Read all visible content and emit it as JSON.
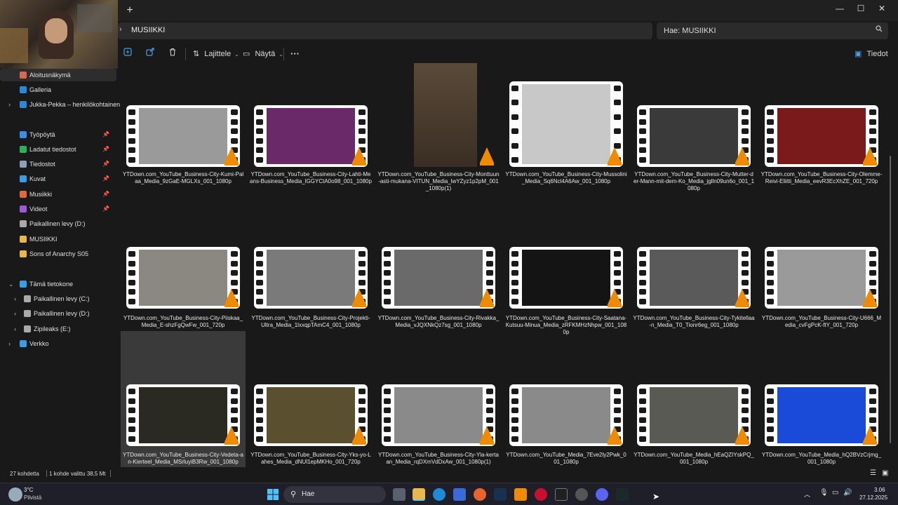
{
  "window": {
    "newtab_glyph": "+",
    "controls": [
      "—",
      "☐",
      "✕"
    ]
  },
  "address": {
    "path": "MUSIIKKI",
    "search_placeholder": "Hae: MUSIIKKI"
  },
  "toolbar": {
    "sort_label": "Lajittele",
    "view_label": "Näytä",
    "more_label": "···",
    "details_label": "Tiedot"
  },
  "sidebar": {
    "items": [
      {
        "label": "Aloitusnäkymä",
        "icon": "home-icon",
        "color": "#d66a4a",
        "selected": true
      },
      {
        "label": "Galleria",
        "icon": "gallery-icon",
        "color": "#2b88d8"
      },
      {
        "label": "Jukka-Pekka – henkilökohtainen",
        "icon": "cloud-icon",
        "color": "#2b88d8"
      },
      {
        "label": "Työpöytä",
        "icon": "desktop-icon",
        "color": "#3a8ee6"
      },
      {
        "label": "Ladatut tiedostot",
        "icon": "download-icon",
        "color": "#2fae60"
      },
      {
        "label": "Tiedostot",
        "icon": "documents-icon",
        "color": "#8aa0b8"
      },
      {
        "label": "Kuvat",
        "icon": "pictures-icon",
        "color": "#3a9be6"
      },
      {
        "label": "Musiikki",
        "icon": "music-icon",
        "color": "#e06a3a"
      },
      {
        "label": "Videot",
        "icon": "videos-icon",
        "color": "#9a5adb"
      },
      {
        "label": "Paikallinen levy (D:)",
        "icon": "drive-icon",
        "color": "#aaaaaa"
      },
      {
        "label": "MUSIIKKI",
        "icon": "folder-icon",
        "color": "#e8b84a"
      },
      {
        "label": "Sons of Anarchy S05",
        "icon": "folder-icon",
        "color": "#e8b84a"
      },
      {
        "label": "Tämä tietokone",
        "icon": "computer-icon",
        "color": "#3a9be6"
      },
      {
        "label": "Paikallinen levy (C:)",
        "icon": "drive-icon",
        "color": "#aaaaaa"
      },
      {
        "label": "Paikallinen levy (D:)",
        "icon": "drive-icon",
        "color": "#aaaaaa"
      },
      {
        "label": "Zipileaks (E:)",
        "icon": "drive-icon",
        "color": "#aaaaaa"
      },
      {
        "label": "Verkko",
        "icon": "network-icon",
        "color": "#3a9be6"
      }
    ]
  },
  "files": [
    {
      "name": "YTDown.com_YouTube_Business-City-Kumi-Palaa_Media_9zGaE-MGLXs_001_1080p",
      "thumb": "#9a9a9a"
    },
    {
      "name": "YTDown.com_YouTube_Business-City-Lahti-Means-Business_Media_lGGYCtA0o98_001_1080p",
      "thumb": "#6a2a6a"
    },
    {
      "name": "YTDown.com_YouTube_Business-City-Monttuun-asti-mukana-VITUN_Media_lwYZyz1p2pM_001_1080p(1)",
      "thumb": "#6b5a45"
    },
    {
      "name": "YTDown.com_YouTube_Business-City-Mussolini_Media_Sq6Ncl4A6Aw_001_1080p",
      "thumb": "#c8c8c8"
    },
    {
      "name": "YTDown.com_YouTube_Business-City-Mutter-der-Mann-mit-dem-Ko_Media_jglln09un6o_001_1080p",
      "thumb": "#3a3a3a"
    },
    {
      "name": "YTDown.com_YouTube_Business-City-Olemme-Reivi-Eliitti_Media_eevR3EcXhZE_001_720p",
      "thumb": "#7a1a1a"
    },
    {
      "name": "YTDown.com_YouTube_Business-City-Piiskaa_Media_E-shzFgQwFw_001_720p",
      "thumb": "#8a8880"
    },
    {
      "name": "YTDown.com_YouTube_Business-City-Projekti-Ultra_Media_1lxxqpTAmC4_001_1080p",
      "thumb": "#7a7a7a"
    },
    {
      "name": "YTDown.com_YouTube_Business-City-Rivakka_Media_vJQXNkQz7sg_001_1080p",
      "thumb": "#6a6a6a"
    },
    {
      "name": "YTDown.com_YouTube_Business-City-Saatana-Kutsuu-Minua_Media_zRFKMHzNhpw_001_1080p",
      "thumb": "#141414"
    },
    {
      "name": "YTDown.com_YouTube_Business-City-Tykitellaa-n_Media_T0_Tionr6eg_001_1080p",
      "thumb": "#5a5a5a"
    },
    {
      "name": "YTDown.com_YouTube_Business-City-U666_Media_cvFgPcK-ftY_001_720p",
      "thumb": "#9a9a9a"
    },
    {
      "name": "YTDown.com_YouTube_Business-City-Vedeta-an-Kierteel_Media_MSrluyiB3Rw_001_1080p",
      "thumb": "#2a2a22"
    },
    {
      "name": "YTDown.com_YouTube_Business-City-Yks-yo-Lahes_Media_dNUl1epMKHo_001_720p",
      "thumb": "#5a5030"
    },
    {
      "name": "YTDown.com_YouTube_Business-City-Yla-kertaan_Media_rqDXmVdDxAw_001_1080p(1)",
      "thumb": "#8a8a8a"
    },
    {
      "name": "YTDown.com_YouTube_Media_7Eve2ly2Pwk_001_1080p",
      "thumb": "#8a8a8a"
    },
    {
      "name": "YTDown.com_YouTube_Media_hEaQZIYskPQ_001_1080p",
      "thumb": "#5a5a55"
    },
    {
      "name": "YTDown.com_YouTube_Media_hQ2BVzCrjmg_001_1080p",
      "thumb": "#1a4ad8"
    }
  ],
  "status": {
    "count": "27 kohdetta",
    "selected": "1 kohde valittu 38,5 Mt"
  },
  "taskbar": {
    "weather_temp": "3°C",
    "weather_desc": "Pilvistä",
    "search_placeholder": "Hae",
    "time": "3.06",
    "date": "27.12.2025"
  }
}
